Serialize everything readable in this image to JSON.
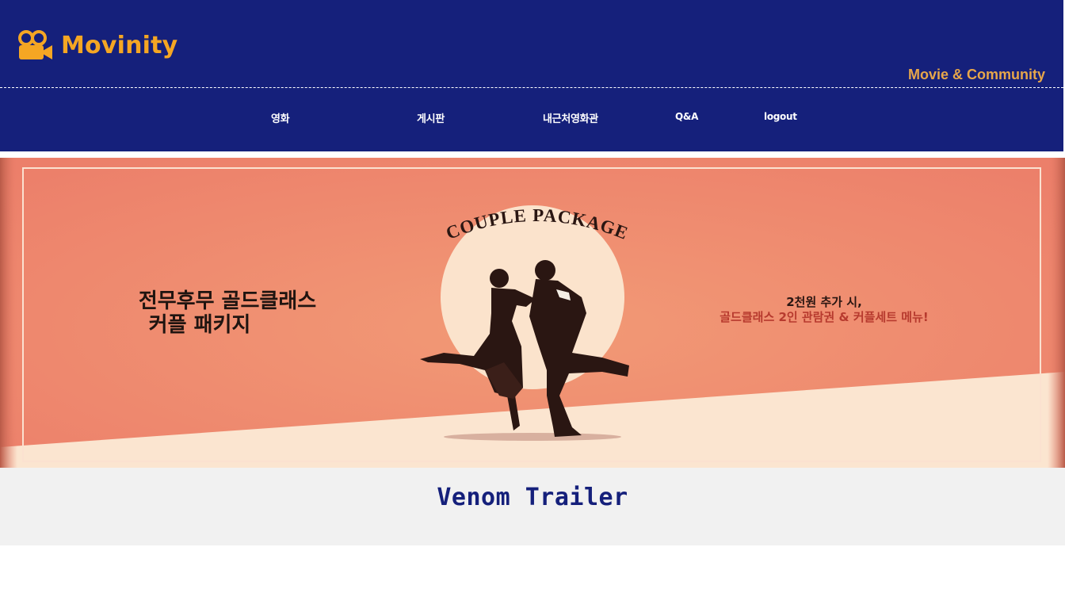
{
  "site": {
    "logo_text": "Movinity",
    "logo_icon": "movie-camera-icon",
    "tagline": "Movie & Community"
  },
  "nav": {
    "items": [
      {
        "label": "영화"
      },
      {
        "label": "게시판"
      },
      {
        "label": "내근처영화관"
      },
      {
        "label": "Q&A"
      },
      {
        "label": "logout"
      }
    ]
  },
  "banner": {
    "arc_text": "COUPLE PACKAGE",
    "headline_line1": "전무후무 골드클래스",
    "headline_line2": "커플 패키지",
    "offer_line1": "2천원 추가 시,",
    "offer_line2": "골드클래스 2인 관람권 & 커플세트 메뉴!"
  },
  "section": {
    "title": "Venom Trailer"
  },
  "colors": {
    "header_bg": "#15207b",
    "accent": "#f5a623",
    "banner_bg": "#ee866c",
    "banner_floor": "#fbe5d0",
    "section_bg": "#f1f1f1",
    "title_color": "#15207b"
  }
}
